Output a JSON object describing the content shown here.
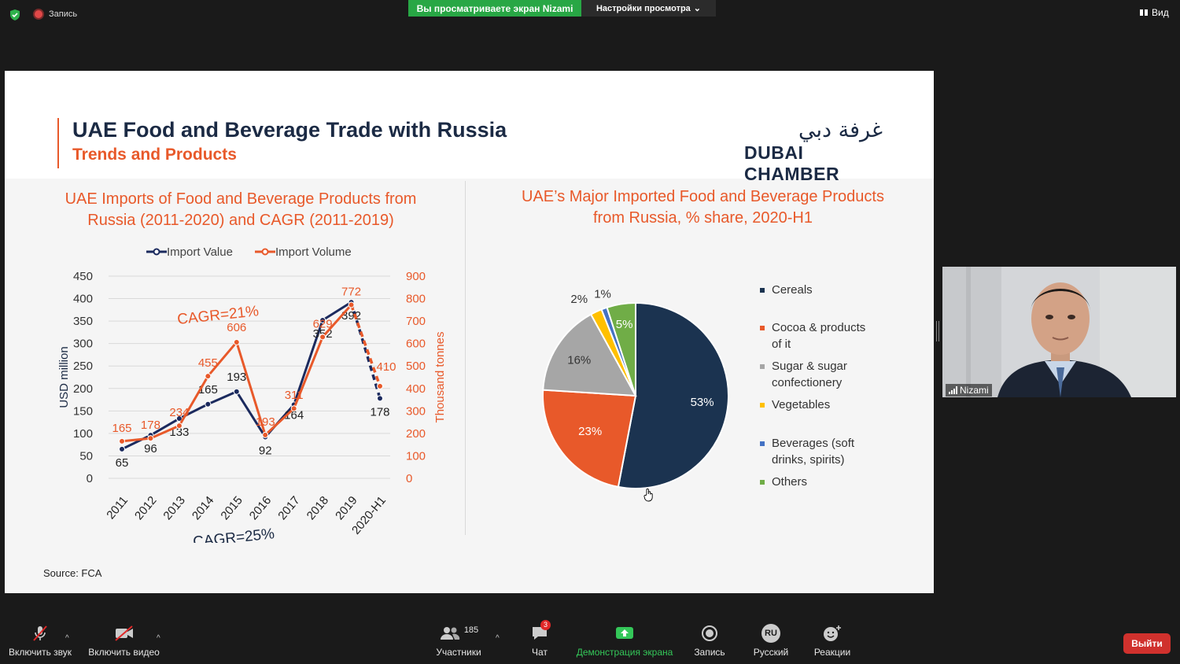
{
  "topbar": {
    "recording_label": "Запись",
    "viewing_banner": "Вы просматриваете экран Nizami",
    "view_options": "Настройки просмотра",
    "view_button": "Вид"
  },
  "slide": {
    "title": "UAE Food and Beverage Trade with Russia",
    "subtitle": "Trends and Products",
    "logo_arabic": "غرفة دبي",
    "logo_english": "DUBAI CHAMBER",
    "left_chart_title_line1": "UAE Imports of Food and Beverage Products from",
    "left_chart_title_line2": "Russia (2011-2020)  and CAGR (2011-2019)",
    "right_chart_title_line1": "UAE’s Major Imported Food and Beverage Products",
    "right_chart_title_line2": "from Russia, % share, 2020-H1",
    "source": "Source: FCA"
  },
  "chart_data": [
    {
      "type": "line",
      "title": "UAE Imports of Food and Beverage Products from Russia (2011-2020)  and CAGR (2011-2019)",
      "x": [
        "2011",
        "2012",
        "2013",
        "2014",
        "2015",
        "2016",
        "2017",
        "2018",
        "2019",
        "2020-H1"
      ],
      "ylabel": "USD million",
      "y2label": "Thousand tonnes",
      "ylim": [
        0,
        450
      ],
      "y2lim": [
        0,
        900
      ],
      "yticks": [
        "0",
        "50",
        "100",
        "150",
        "200",
        "250",
        "300",
        "350",
        "400",
        "450"
      ],
      "y2ticks": [
        "0",
        "100",
        "200",
        "300",
        "400",
        "500",
        "600",
        "700",
        "800",
        "900"
      ],
      "legend_position": "top",
      "series": [
        {
          "name": "Import Value",
          "axis": "left",
          "color": "#1b2a5e",
          "values": [
            65,
            96,
            133,
            165,
            193,
            92,
            164,
            352,
            392,
            178
          ],
          "labels": [
            "65",
            "96",
            "133",
            "165",
            "193",
            "92",
            "164",
            "352",
            "392",
            "178"
          ]
        },
        {
          "name": "Import Volume",
          "axis": "right",
          "color": "#e8592a",
          "values": [
            165,
            178,
            234,
            455,
            606,
            193,
            311,
            629,
            772,
            410
          ],
          "labels": [
            "165",
            "178",
            "234",
            "455",
            "606",
            "193",
            "311",
            "629",
            "772",
            "410"
          ]
        }
      ],
      "annotations": [
        "CAGR=21%",
        "CAGR=25%"
      ],
      "annotation_colors": [
        "#e8592a",
        "#1b2a44"
      ]
    },
    {
      "type": "pie",
      "title": "UAE’s Major Imported Food and Beverage Products from Russia, % share, 2020-H1",
      "categories": [
        "Cereals",
        "Cocoa & products of it",
        "Sugar & sugar confectionery",
        "Vegetables",
        "Beverages (soft drinks, spirits)",
        "Others"
      ],
      "values": [
        53,
        23,
        16,
        2,
        1,
        5
      ],
      "labels": [
        "53%",
        "23%",
        "16%",
        "2%",
        "1%",
        "5%"
      ],
      "colors": [
        "#1b3350",
        "#e8592a",
        "#a6a6a6",
        "#ffc000",
        "#4472c4",
        "#70ad47"
      ],
      "legend_position": "right"
    }
  ],
  "legend_lines": [
    [
      "Cereals"
    ],
    [
      "Cocoa & products",
      "of it"
    ],
    [
      "Sugar & sugar",
      "confectionery"
    ],
    [
      "Vegetables"
    ],
    [
      "Beverages (soft",
      "drinks, spirits)"
    ],
    [
      "Others"
    ]
  ],
  "camera": {
    "name": "Nizami"
  },
  "toolbar": {
    "unmute": "Включить звук",
    "start_video": "Включить видео",
    "participants_count": "185",
    "participants": "Участники",
    "chat_badge": "3",
    "chat": "Чат",
    "share_screen": "Демонстрация экрана",
    "record": "Запись",
    "language_code": "RU",
    "language": "Русский",
    "reactions": "Реакции",
    "leave": "Выйти"
  }
}
